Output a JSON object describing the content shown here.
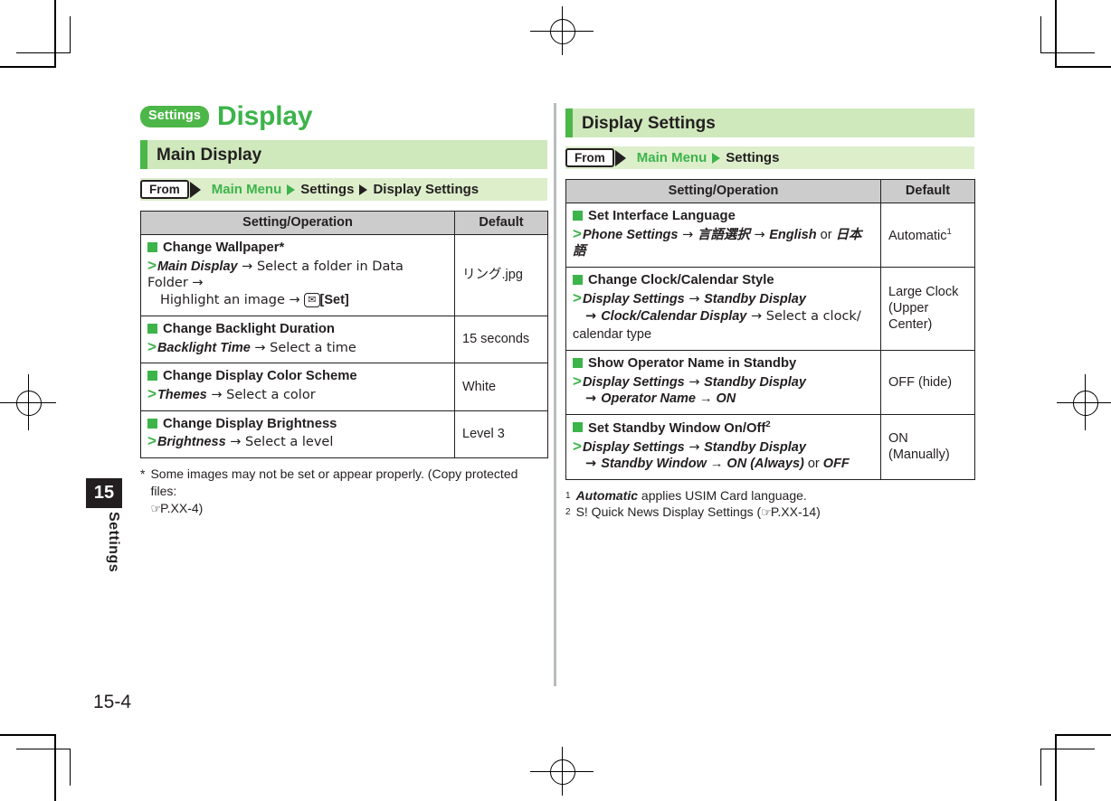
{
  "doc": {
    "category_badge": "Settings",
    "title": "Display",
    "page_number": "15-4",
    "side_tab_number": "15",
    "side_tab_label": "Settings"
  },
  "left": {
    "section_heading": "Main Display",
    "from": {
      "label": "From",
      "crumbs": [
        "Main Menu",
        "Settings",
        "Display Settings"
      ]
    },
    "table": {
      "headers": [
        "Setting/Operation",
        "Default"
      ],
      "rows": [
        {
          "heading": "Change Wallpaper*",
          "op_line1_bold": "Main Display",
          "op_line1_rest": " → Select a folder in Data Folder →",
          "op_line2_pre": "Highlight an image → ",
          "op_key_icon": "✉",
          "op_line2_post": "[Set]",
          "default": "リング.jpg"
        },
        {
          "heading": "Change Backlight Duration",
          "op_line1_bold": "Backlight Time",
          "op_line1_rest": " → Select a time",
          "default": "15 seconds"
        },
        {
          "heading": "Change Display Color Scheme",
          "op_line1_bold": "Themes",
          "op_line1_rest": " → Select a color",
          "default": "White"
        },
        {
          "heading": "Change Display Brightness",
          "op_line1_bold": "Brightness",
          "op_line1_rest": " → Select a level",
          "default": "Level 3"
        }
      ]
    },
    "footnotes": [
      {
        "mark": "*",
        "text": "Some images may not be set or appear properly. (Copy protected files:",
        "text2_ref": "P.XX-4)"
      }
    ]
  },
  "right": {
    "section_heading": "Display Settings",
    "from": {
      "label": "From",
      "crumbs": [
        "Main Menu",
        "Settings"
      ]
    },
    "table": {
      "headers": [
        "Setting/Operation",
        "Default"
      ],
      "rows": [
        {
          "heading": "Set Interface Language",
          "heading_sup": "",
          "op_b1": "Phone Settings",
          "op_t1": " → ",
          "op_b2": "言語選択",
          "op_t2": " → ",
          "op_b3": "English",
          "op_t3": " or ",
          "op_b4": "日本語",
          "default": "Automatic",
          "default_sup": "1"
        },
        {
          "heading": "Change Clock/Calendar Style",
          "op_b1": "Display Settings",
          "op_t1": " → ",
          "op_b2": "Standby Display",
          "op_l2_arrow": "→ ",
          "op_l2_bold": "Clock/Calendar Display",
          "op_l2_rest": " → Select a clock/",
          "op_l3": "calendar type",
          "default": "Large Clock\n(Upper Center)"
        },
        {
          "heading": "Show Operator Name in Standby",
          "op_b1": "Display Settings",
          "op_t1": " → ",
          "op_b2": "Standby Display",
          "op_l2_arrow": "→ ",
          "op_l2_bold": "Operator Name → ON",
          "default": "OFF (hide)"
        },
        {
          "heading": "Set Standby Window On/Off",
          "heading_sup": "2",
          "op_b1": "Display Settings",
          "op_t1": " → ",
          "op_b2": "Standby Display",
          "op_l2_arrow": "→ ",
          "op_l2_bold": "Standby Window → ON (Always)",
          "op_l2_mid": " or ",
          "op_l2_bold2": "OFF",
          "default": "ON (Manually)"
        }
      ]
    },
    "footnotes": [
      {
        "mark": "1",
        "bold_lead": "Automatic",
        "text": " applies USIM Card language."
      },
      {
        "mark": "2",
        "text": "S! Quick News Display Settings (",
        "ref": "P.XX-14)"
      }
    ]
  },
  "colors": {
    "brand_green": "#3cb44a",
    "band_green": "#cfe8bc",
    "frombar_green": "#ddeecb",
    "table_header_gray": "#cccccc",
    "ink": "#231f20"
  }
}
